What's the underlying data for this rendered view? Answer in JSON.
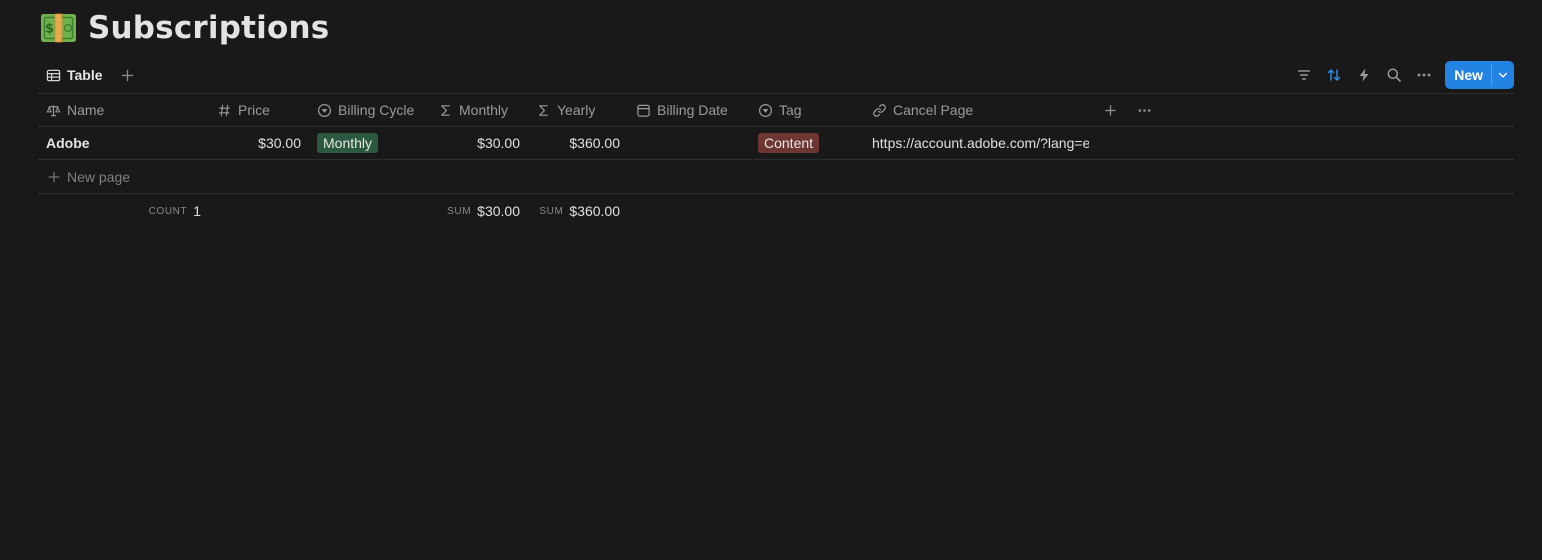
{
  "page": {
    "title": "Subscriptions",
    "icon": "money-bill-icon"
  },
  "view_bar": {
    "tab_label": "Table",
    "new_button_label": "New",
    "accent_color": "#2383e2"
  },
  "table": {
    "columns": [
      {
        "key": "name",
        "label": "Name",
        "icon": "title-icon"
      },
      {
        "key": "price",
        "label": "Price",
        "icon": "number-icon"
      },
      {
        "key": "billing_cycle",
        "label": "Billing Cycle",
        "icon": "select-icon"
      },
      {
        "key": "monthly",
        "label": "Monthly",
        "icon": "formula-icon"
      },
      {
        "key": "yearly",
        "label": "Yearly",
        "icon": "formula-icon"
      },
      {
        "key": "billing_date",
        "label": "Billing Date",
        "icon": "calendar-icon"
      },
      {
        "key": "tag",
        "label": "Tag",
        "icon": "select-icon"
      },
      {
        "key": "cancel_page",
        "label": "Cancel Page",
        "icon": "link-icon"
      }
    ],
    "rows": [
      {
        "name": "Adobe",
        "price": "$30.00",
        "billing_cycle": "Monthly",
        "billing_cycle_color": "#2b593f",
        "monthly": "$30.00",
        "yearly": "$360.00",
        "billing_date": "",
        "tag": "Content",
        "tag_color": "#6e3630",
        "cancel_page": "https://account.adobe.com/?lang=e"
      }
    ],
    "new_page_label": "New page",
    "calculations": {
      "count_label": "COUNT",
      "count_value": "1",
      "monthly_label": "SUM",
      "monthly_value": "$30.00",
      "yearly_label": "SUM",
      "yearly_value": "$360.00"
    }
  }
}
